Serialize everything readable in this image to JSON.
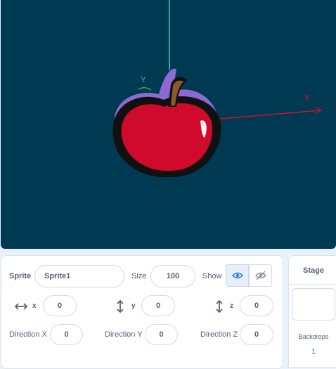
{
  "stage": {
    "axis_x_label": "X",
    "axis_y_label": "Y"
  },
  "sprite_info": {
    "sprite_label": "Sprite",
    "sprite_name": "Sprite1",
    "size_label": "Size",
    "size_value": "100",
    "show_label": "Show",
    "x_label": "x",
    "x_value": "0",
    "y_label": "y",
    "y_value": "0",
    "z_label": "z",
    "z_value": "0",
    "direction_x_label": "Direction X",
    "direction_x_value": "0",
    "direction_y_label": "Direction Y",
    "direction_y_value": "0",
    "direction_z_label": "Direction Z",
    "direction_z_value": "0"
  },
  "stage_panel": {
    "title": "Stage",
    "backdrops_label": "Backdrops",
    "backdrops_count": "1"
  },
  "colors": {
    "stage_bg": "#003a52",
    "axis_x": "#d0122f",
    "axis_y": "#12a8c8",
    "toggle_accent": "#3d8fd6"
  },
  "icons": {
    "show": "eye-icon",
    "hide": "eye-slash-icon",
    "x_axis": "horizontal-arrows-icon",
    "y_axis": "vertical-arrows-icon",
    "z_axis": "vertical-arrows-icon"
  }
}
